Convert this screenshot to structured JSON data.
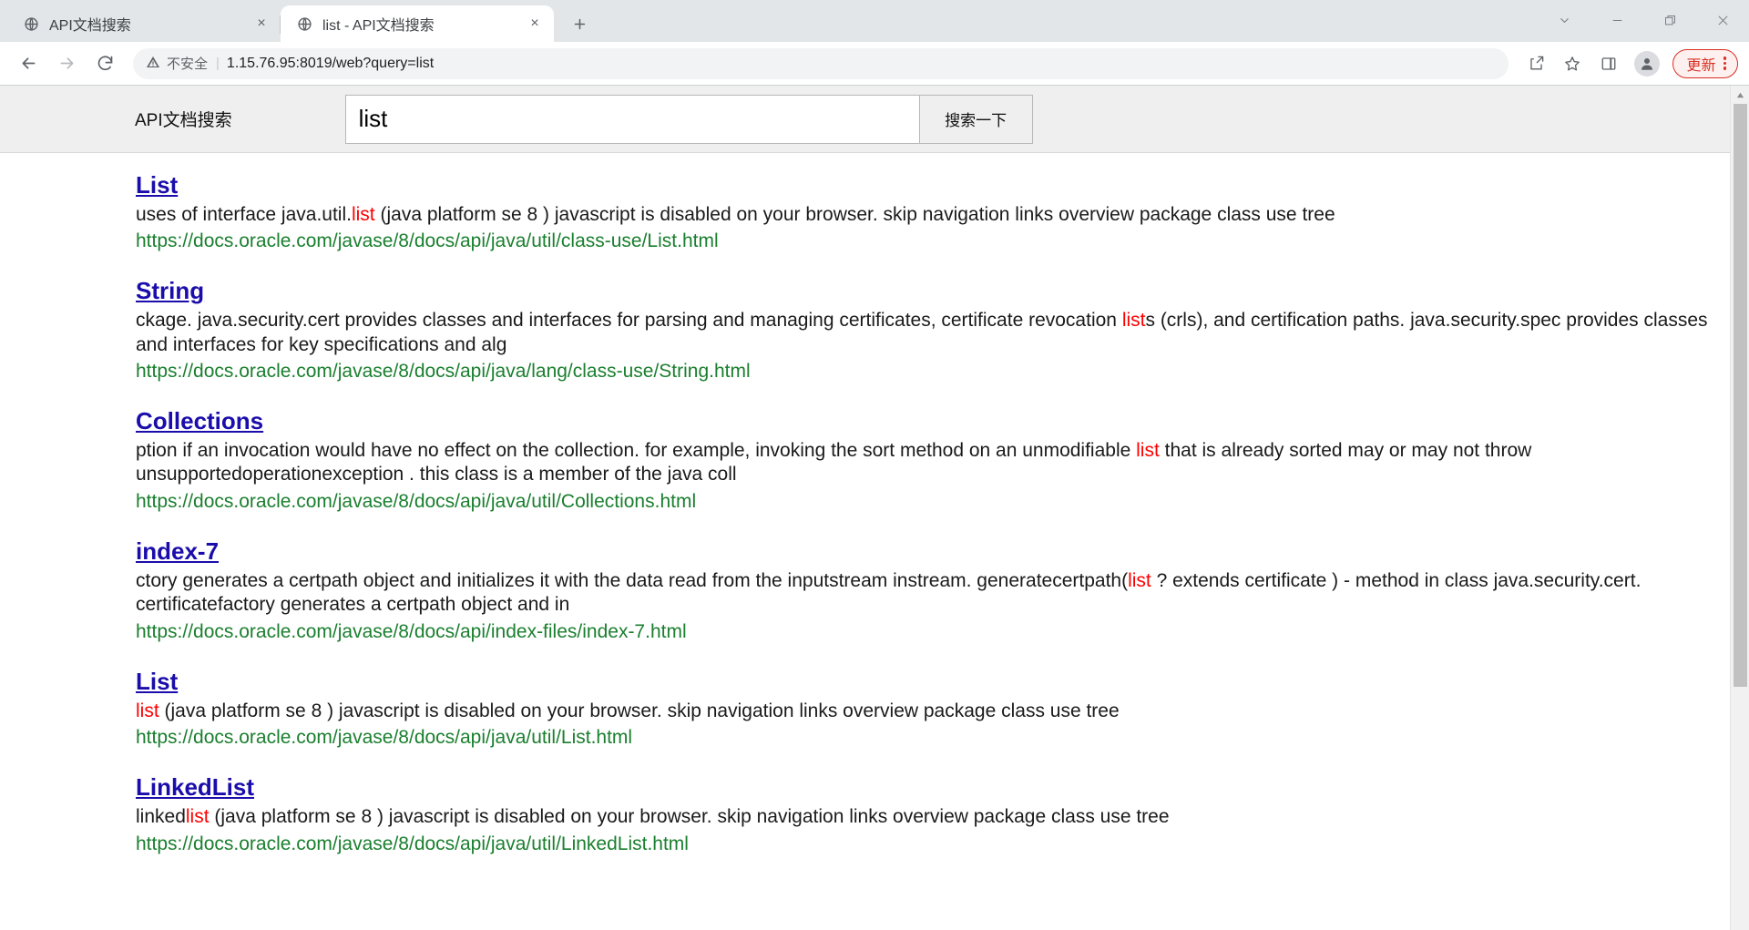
{
  "browser": {
    "tabs": [
      {
        "title": "API文档搜索",
        "favicon": "globe-icon",
        "active": false,
        "close_label": "×"
      },
      {
        "title": "list - API文档搜索",
        "favicon": "globe-icon",
        "active": true,
        "close_label": "×"
      }
    ],
    "new_tab_label": "+",
    "window_controls": {
      "tab_search": "⌄",
      "minimize": "—",
      "maximize": "❐",
      "close": "✕"
    },
    "toolbar": {
      "back": "←",
      "forward": "→",
      "reload": "↻",
      "security_icon": "warning-triangle-icon",
      "security_text": "不安全",
      "separator": "|",
      "url": "1.15.76.95:8019/web?query=list",
      "share": "share-icon",
      "bookmark": "star-icon",
      "side_panel": "side-panel-icon",
      "profile": "person-icon",
      "update_label": "更新",
      "menu": "three-dot-menu-icon"
    }
  },
  "page": {
    "header": {
      "brand": "API文档搜索",
      "query_value": "list",
      "query_placeholder": "",
      "submit_label": "搜索一下"
    },
    "results": [
      {
        "title": "List",
        "snippet_parts": [
          {
            "text": "uses of interface java.util.",
            "highlight": false
          },
          {
            "text": "list",
            "highlight": true
          },
          {
            "text": " (java platform se 8 ) javascript is disabled on your browser. skip navigation links overview package class use tree",
            "highlight": false
          }
        ],
        "url": "https://docs.oracle.com/javase/8/docs/api/java/util/class-use/List.html"
      },
      {
        "title": "String",
        "snippet_parts": [
          {
            "text": "ckage. java.security.cert provides classes and interfaces for parsing and managing certificates, certificate revocation ",
            "highlight": false
          },
          {
            "text": "list",
            "highlight": true
          },
          {
            "text": "s (crls), and certification paths. java.security.spec provides classes and interfaces for key specifications and alg",
            "highlight": false
          }
        ],
        "url": "https://docs.oracle.com/javase/8/docs/api/java/lang/class-use/String.html"
      },
      {
        "title": "Collections",
        "snippet_parts": [
          {
            "text": "ption if an invocation would have no effect on the collection. for example, invoking the sort method on an unmodifiable ",
            "highlight": false
          },
          {
            "text": "list",
            "highlight": true
          },
          {
            "text": " that is already sorted may or may not throw unsupportedoperationexception . this class is a member of the java coll",
            "highlight": false
          }
        ],
        "url": "https://docs.oracle.com/javase/8/docs/api/java/util/Collections.html"
      },
      {
        "title": "index-7",
        "snippet_parts": [
          {
            "text": "ctory generates a certpath object and initializes it with the data read from the inputstream instream. generatecertpath(",
            "highlight": false
          },
          {
            "text": "list",
            "highlight": true
          },
          {
            "text": " ? extends certificate ) - method in class java.security.cert. certificatefactory generates a certpath object and in",
            "highlight": false
          }
        ],
        "url": "https://docs.oracle.com/javase/8/docs/api/index-files/index-7.html"
      },
      {
        "title": "List",
        "snippet_parts": [
          {
            "text": "list",
            "highlight": true
          },
          {
            "text": " (java platform se 8 ) javascript is disabled on your browser. skip navigation links overview package class use tree",
            "highlight": false
          }
        ],
        "url": "https://docs.oracle.com/javase/8/docs/api/java/util/List.html"
      },
      {
        "title": "LinkedList",
        "snippet_parts": [
          {
            "text": "linked",
            "highlight": false
          },
          {
            "text": "list",
            "highlight": true
          },
          {
            "text": " (java platform se 8 ) javascript is disabled on your browser. skip navigation links overview package class use tree",
            "highlight": false
          }
        ],
        "url": "https://docs.oracle.com/javase/8/docs/api/java/util/LinkedList.html"
      }
    ],
    "scrollbar": {
      "up_arrow": "▲"
    }
  },
  "colors": {
    "link": "#1a0dab",
    "url": "#1a7f2e",
    "highlight": "#ff0000",
    "update_accent": "#d93025",
    "header_bg": "#efefef"
  }
}
